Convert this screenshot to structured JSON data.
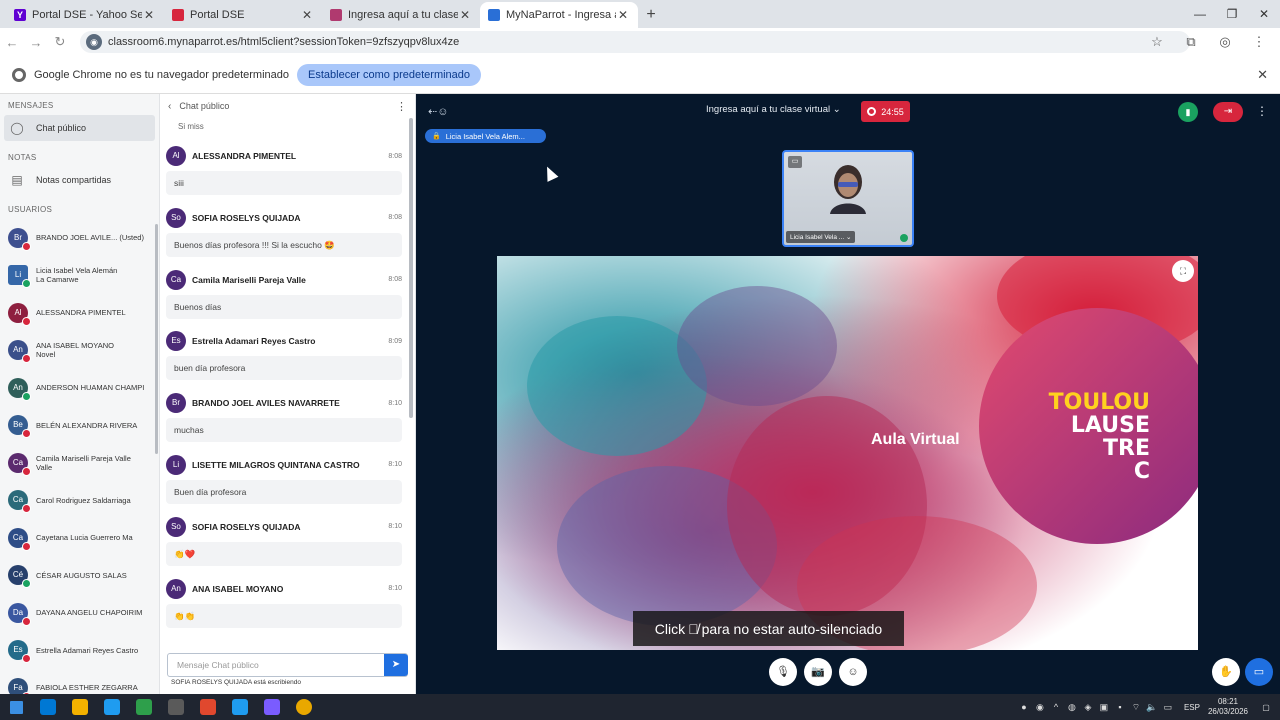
{
  "browser": {
    "tabs": [
      {
        "label": "Portal DSE - Yahoo Search Tu r",
        "favicon_color": "#6001d2",
        "favicon": "Y",
        "active": false
      },
      {
        "label": "Portal DSE",
        "favicon_color": "#d7263d",
        "favicon": "",
        "active": false
      },
      {
        "label": "Ingresa aquí a tu clase virtual | M",
        "favicon_color": "#b03a6f",
        "favicon": "",
        "active": false
      },
      {
        "label": "MyNaParrot - Ingresa aquí",
        "favicon_color": "#2a6fd6",
        "favicon": "",
        "active": true
      }
    ],
    "url": "classroom6.mynaparrot.es/html5client?sessionToken=9zfszyqpv8lux4ze",
    "infobar_message": "Google Chrome no es tu navegador predeterminado",
    "infobar_button": "Establecer como predeterminado"
  },
  "sidebar": {
    "messages_title": "MENSAJES",
    "public_chat": "Chat público",
    "notes_title": "NOTAS",
    "shared_notes": "Notas compartidas",
    "users_title": "USUARIOS",
    "users": [
      {
        "initials": "Br",
        "name": "BRANDO JOEL AVILE... (Usted)",
        "color": "#3d4f8f",
        "mic": "muted"
      },
      {
        "initials": "Li",
        "name": "Licia Isabel Vela Alemán\nLa Camarwe",
        "color": "#3567a8",
        "mic": "on",
        "square": true
      },
      {
        "initials": "Al",
        "name": "ALESSANDRA PIMENTEL",
        "color": "#8e1f3f",
        "mic": "muted"
      },
      {
        "initials": "An",
        "name": "ANA ISABEL MOYANO\nNovel",
        "color": "#3a4f8a",
        "mic": "muted"
      },
      {
        "initials": "An",
        "name": "ANDERSON HUAMAN CHAMPI",
        "color": "#2f5f5a",
        "mic": "on"
      },
      {
        "initials": "Be",
        "name": "BELÉN ALEXANDRA RIVERA",
        "color": "#345d91",
        "mic": "muted"
      },
      {
        "initials": "Ca",
        "name": "Camila Mariselli Pareja Valle\nValle",
        "color": "#5b2a6e",
        "mic": "muted"
      },
      {
        "initials": "Ca",
        "name": "Carol Rodriguez Saldarriaga",
        "color": "#2b6a7a",
        "mic": "muted"
      },
      {
        "initials": "Ca",
        "name": "Cayetana Lucia Guerrero Ma",
        "color": "#2e4d87",
        "mic": "muted"
      },
      {
        "initials": "Cé",
        "name": "CÉSAR AUGUSTO SALAS",
        "color": "#27406c",
        "mic": "on"
      },
      {
        "initials": "Da",
        "name": "DAYANA ANGELU CHAPOIRIM",
        "color": "#3a57a0",
        "mic": "muted"
      },
      {
        "initials": "Es",
        "name": "Estrella Adamari Reyes Castro",
        "color": "#236b8a",
        "mic": "muted"
      },
      {
        "initials": "Fa",
        "name": "FABIOLA ESTHER ZEGARRA",
        "color": "#2f4f7a",
        "mic": "muted"
      }
    ]
  },
  "chat": {
    "title": "Chat público",
    "first_message": "Si miss",
    "messages": [
      {
        "initials": "Al",
        "name": "ALESSANDRA PIMENTEL",
        "time": "8:08",
        "text": "siii"
      },
      {
        "initials": "So",
        "name": "SOFIA ROSELYS QUIJADA",
        "time": "8:08",
        "text": "Buenos días profesora !!! Si la escucho 🤩"
      },
      {
        "initials": "Ca",
        "name": "Camila Mariselli Pareja Valle",
        "time": "8:08",
        "text": "Buenos días"
      },
      {
        "initials": "Es",
        "name": "Estrella Adamari Reyes Castro",
        "time": "8:09",
        "text": "buen día profesora"
      },
      {
        "initials": "Br",
        "name": "BRANDO JOEL AVILES NAVARRETE",
        "time": "8:10",
        "text": "muchas"
      },
      {
        "initials": "Li",
        "name": "LISETTE MILAGROS QUINTANA CASTRO",
        "time": "8:10",
        "text": "Buen día profesora"
      },
      {
        "initials": "So",
        "name": "SOFIA ROSELYS QUIJADA",
        "time": "8:10",
        "text": "👏❤️"
      },
      {
        "initials": "An",
        "name": "ANA ISABEL MOYANO",
        "time": "8:10",
        "text": "👏👏"
      }
    ],
    "input_placeholder": "Mensaje Chat público",
    "typing": "SOFIA ROSELYS QUIJADA está escribiendo"
  },
  "meeting": {
    "title": "Ingresa aquí a tu clase virtual",
    "recording_time": "24:55",
    "presenter": "Licia Isabel Vela Alem...",
    "webcam_name": "Licia Isabel Vela ...",
    "slide_title": "Aula Virtual",
    "brand_lines": [
      "TOULOU",
      "LAUSE",
      "TRE",
      "C"
    ],
    "toast_before": "Click",
    "toast_after": "para no estar auto-silenciado"
  },
  "taskbar": {
    "apps": [
      "#0078d4",
      "#f3b200",
      "#1f9cf0",
      "#2e9f4b",
      "#5a5a5a",
      "#e0482e",
      "#1f9cf0",
      "#7a5cff",
      "#e9a800"
    ],
    "lang": "ESP",
    "time": "08:21",
    "date": "26/03/2026"
  },
  "colors": {
    "accent": "#1f6fe0",
    "danger": "#d7263d",
    "success": "#1aa260",
    "bg_main": "#06172b"
  }
}
